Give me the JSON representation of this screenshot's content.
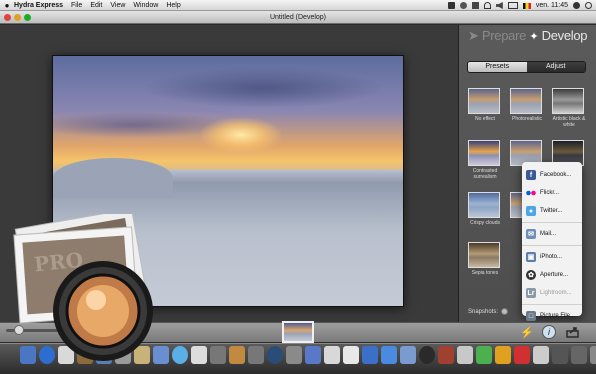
{
  "menubar": {
    "app_name": "Hydra Express",
    "items": [
      "File",
      "Edit",
      "View",
      "Window",
      "Help"
    ],
    "clock": "ven. 11:45"
  },
  "window": {
    "title": "Untitled (Develop)"
  },
  "brand": {
    "prepare": "Prepare",
    "develop": "Develop"
  },
  "tabs": [
    {
      "label": "Presets",
      "active": false
    },
    {
      "label": "Adjust",
      "active": true
    }
  ],
  "presets": [
    {
      "label": "No effect",
      "style": "normal"
    },
    {
      "label": "Photorealistic",
      "style": "normal"
    },
    {
      "label": "Artistic black & white",
      "style": "bw"
    },
    {
      "label": "Contrasted surrealism",
      "style": "surreal"
    },
    {
      "label": "Soft",
      "style": "normal"
    },
    {
      "label": "",
      "style": "dark"
    },
    {
      "label": "Crispy clouds",
      "style": "blue"
    },
    {
      "label": "",
      "style": "normal"
    },
    {
      "label": "Sepia tones",
      "style": "sepia"
    }
  ],
  "snapshots": {
    "label": "Snapshots:"
  },
  "share_menu": {
    "items": [
      {
        "label": "Facebook...",
        "icon": "facebook-icon",
        "color": "#3b5998",
        "enabled": true
      },
      {
        "label": "Flickr...",
        "icon": "flickr-icon",
        "color": "#ff0084",
        "enabled": true
      },
      {
        "label": "Twitter...",
        "icon": "twitter-icon",
        "color": "#4aa6e8",
        "enabled": true
      },
      {
        "label": "Mail...",
        "icon": "mail-icon",
        "color": "#6f8fb8",
        "enabled": true
      },
      {
        "label": "iPhoto...",
        "icon": "iphoto-icon",
        "color": "#5a7fb0",
        "enabled": true
      },
      {
        "label": "Aperture...",
        "icon": "aperture-icon",
        "color": "#333333",
        "enabled": true
      },
      {
        "label": "Lightroom...",
        "icon": "lightroom-icon",
        "color": "#8a9aa6",
        "enabled": false
      },
      {
        "label": "Picture File...",
        "icon": "picture-file-icon",
        "color": "#6a7a8a",
        "enabled": true
      }
    ]
  },
  "logo": {
    "text": "PRO"
  },
  "colors": {
    "panel_bg": "#555555",
    "tab_active": "#d8d8d8",
    "menu_bg": "#f2f2f2"
  }
}
